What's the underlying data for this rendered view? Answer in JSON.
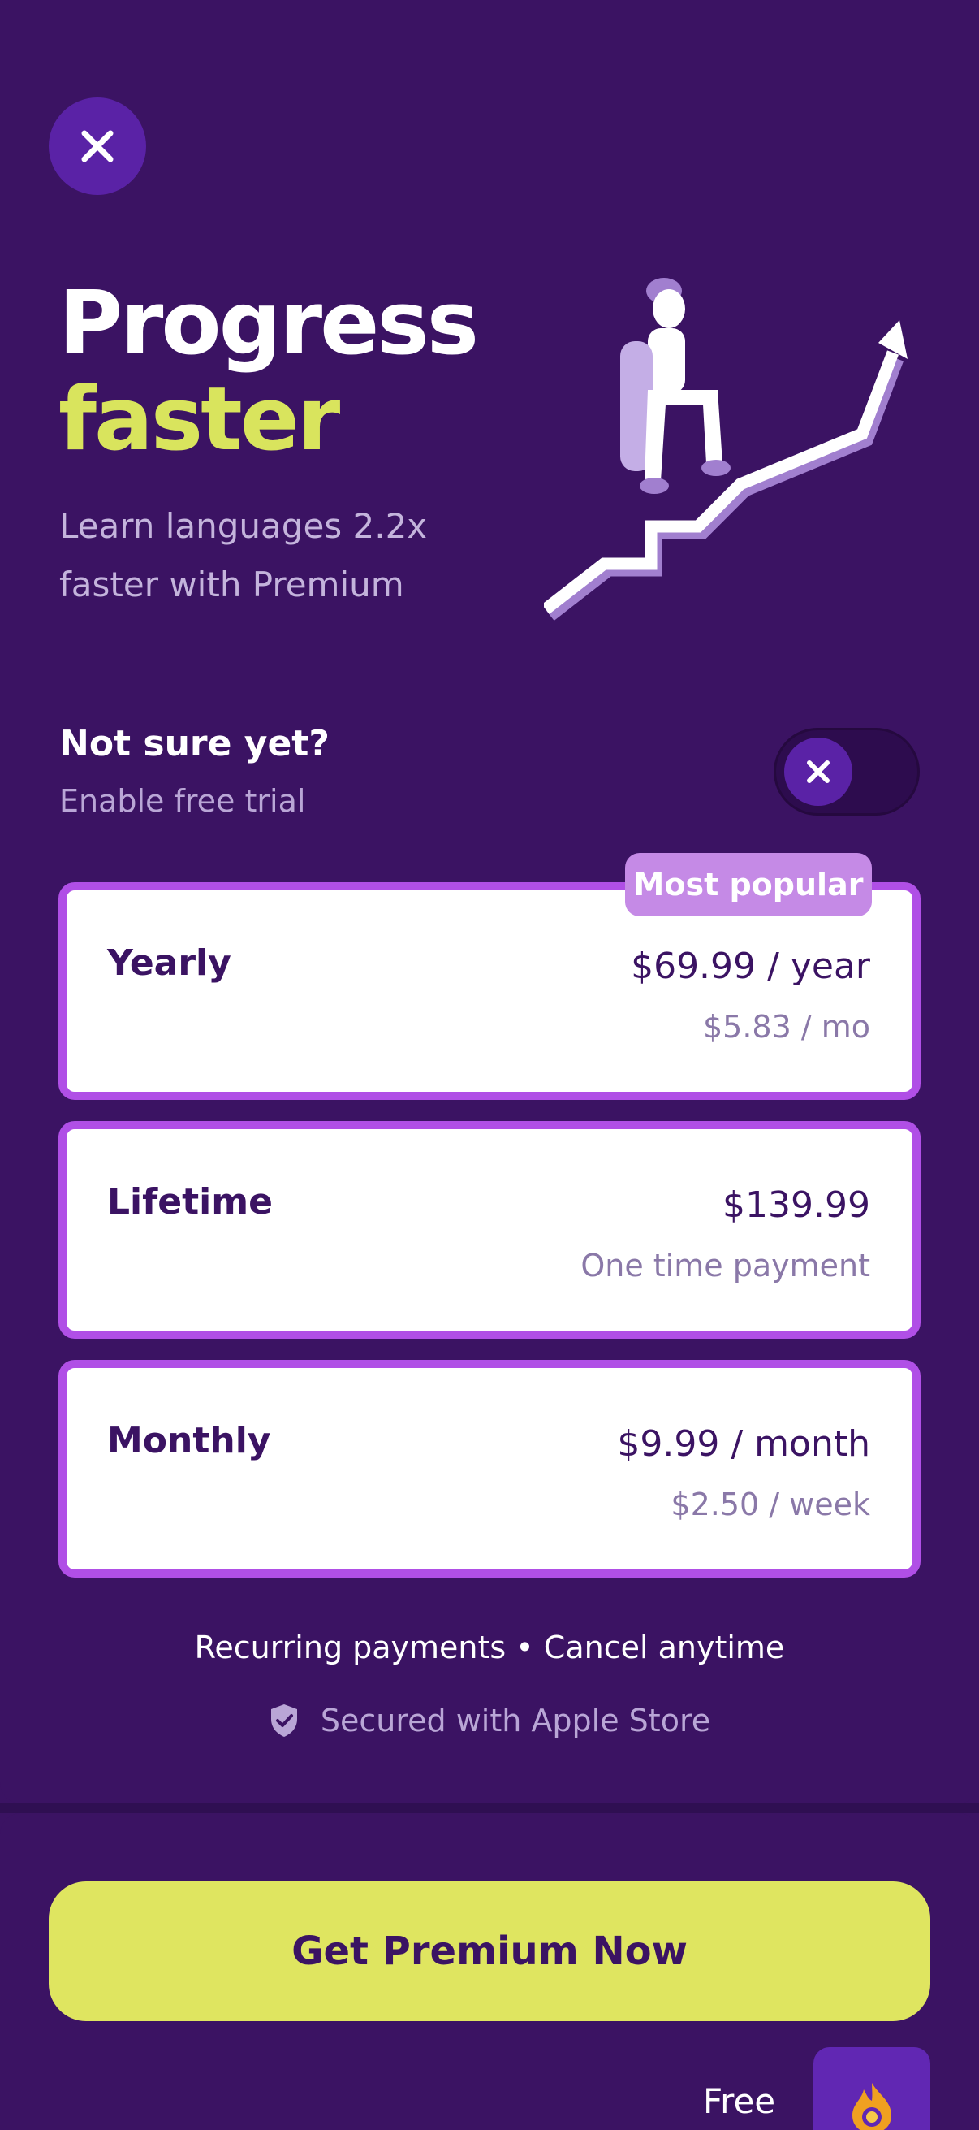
{
  "header": {
    "close_icon": "close-icon",
    "title_line1": "Progress",
    "title_line2": "faster",
    "subtitle": "Learn languages 2.2x faster with Premium",
    "illustration": "person-climbing-stairs-arrow"
  },
  "trial": {
    "title": "Not sure yet?",
    "subtitle": "Enable free trial",
    "toggle_on": false
  },
  "plans": [
    {
      "name": "Yearly",
      "price": "$69.99 / year",
      "sub": "$5.83 / mo",
      "badge": "Most popular"
    },
    {
      "name": "Lifetime",
      "price": "$139.99",
      "sub": "One time payment"
    },
    {
      "name": "Monthly",
      "price": "$9.99 / month",
      "sub": "$2.50 / week"
    }
  ],
  "footer": {
    "recurring": "Recurring payments • Cancel anytime",
    "secured": "Secured with Apple Store",
    "secured_icon": "shield-check-icon"
  },
  "cta": {
    "label": "Get Premium Now",
    "free_label": "Free",
    "free_icon": "flame-coin-icon"
  },
  "colors": {
    "background": "#3b1363",
    "accent_yellow": "#d9e45d",
    "card_border": "#b04fe6",
    "badge": "#c58ae6",
    "button_purple": "#5a22a6"
  }
}
